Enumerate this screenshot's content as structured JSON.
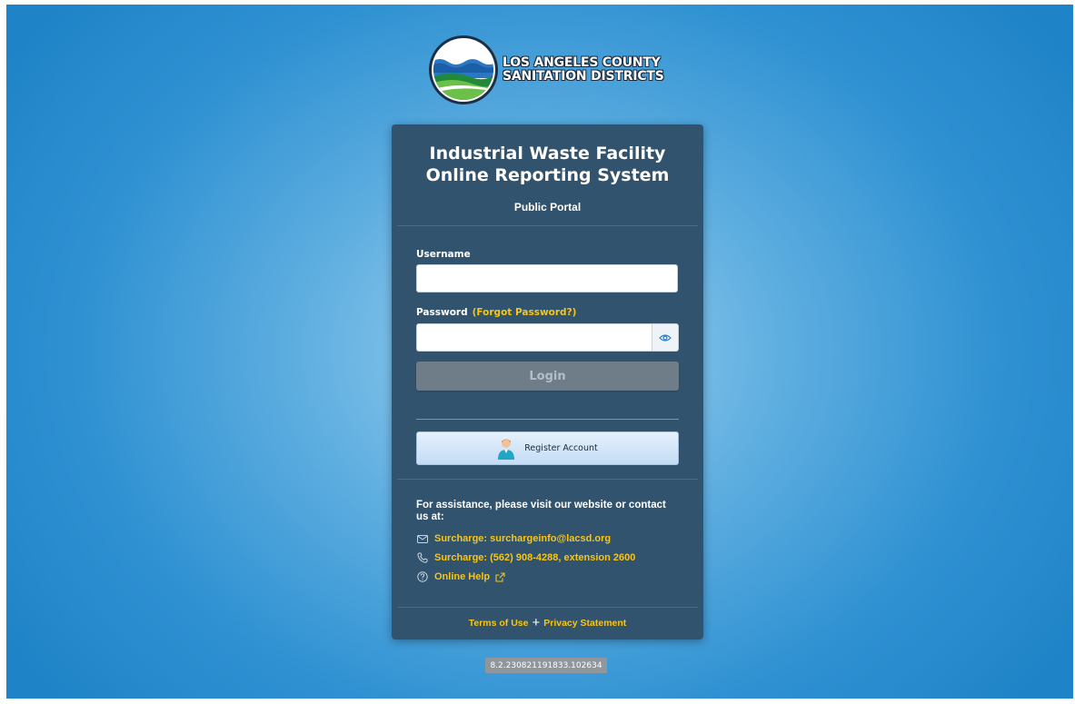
{
  "org": {
    "line1": "LOS ANGELES COUNTY",
    "line2": "SANITATION DISTRICTS"
  },
  "card": {
    "title_line1": "Industrial Waste Facility",
    "title_line2": "Online Reporting System",
    "subtitle": "Public Portal"
  },
  "form": {
    "username_label": "Username",
    "username_value": "",
    "password_label": "Password",
    "forgot_label": "(Forgot Password?)",
    "password_value": "",
    "login_label": "Login",
    "register_label": "Register Account"
  },
  "assist": {
    "intro": "For assistance, please visit our website or contact us at:",
    "email": "Surcharge: surchargeinfo@lacsd.org",
    "phone": "Surcharge: (562) 908-4288, extension 2600",
    "help": "Online Help"
  },
  "footer": {
    "terms": "Terms of Use",
    "privacy": "Privacy Statement"
  },
  "version": "8.2.230821191833.102634",
  "icons": {
    "logo": "sanitation-districts-logo-icon",
    "eye": "eye-icon",
    "person": "person-icon",
    "email": "envelope-icon",
    "phone": "phone-icon",
    "help": "question-circle-icon",
    "external": "external-link-icon",
    "plus": "plus-icon"
  },
  "colors": {
    "card_bg": "#32536e",
    "link": "#f5c518",
    "login_disabled": "#6f7d88",
    "page_bg": "#2f91d2"
  }
}
